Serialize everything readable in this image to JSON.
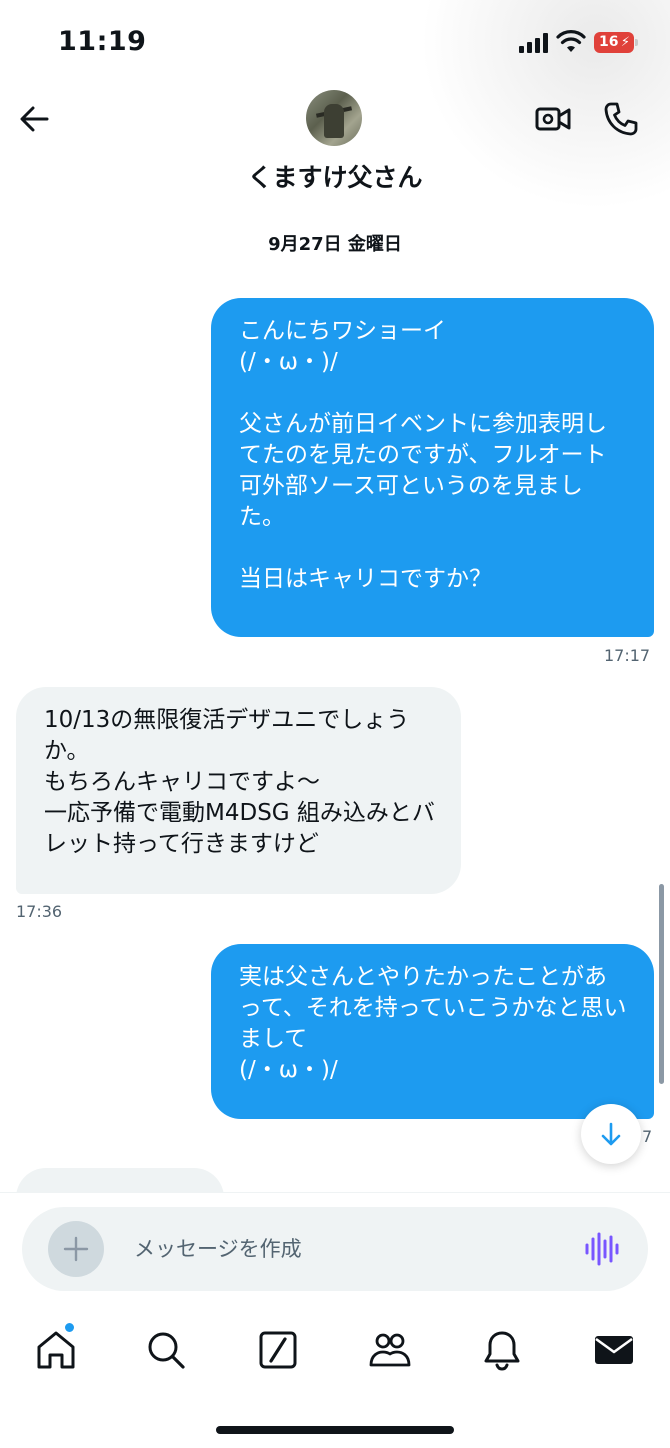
{
  "status_bar": {
    "time": "11:19",
    "battery": "16"
  },
  "header": {
    "contact_name": "くますけ父さん"
  },
  "conversation": {
    "date_separator": "9月27日 金曜日",
    "messages": [
      {
        "direction": "sent",
        "text": "こんにちワショーイ\n(/・ω・)/\n\n父さんが前日イベントに参加表明してたのを見たのですが、フルオート可外部ソース可というのを見ました。\n\n当日はキャリコですか？",
        "time": "17:17"
      },
      {
        "direction": "received",
        "text": "10/13の無限復活デザユニでしょうか。\nもちろんキャリコですよ～\n一応予備で電動M4DSG 組み込みとバレット持って行きますけど",
        "time": "17:36"
      },
      {
        "direction": "sent",
        "text": "実は父さんとやりたかったことがあって、それを持っていこうかなと思いまして\n(/・ω・)/",
        "time": "7"
      }
    ]
  },
  "composer": {
    "placeholder": "メッセージを作成"
  },
  "colors": {
    "accent": "#1d9bf0",
    "received_bubble": "#eff3f4",
    "battery_low": "#e0413a",
    "voice_icon": "#7856ff"
  },
  "icons": [
    "back-arrow-icon",
    "video-call-icon",
    "phone-icon",
    "plus-icon",
    "voice-waveform-icon",
    "arrow-down-icon",
    "home-icon",
    "search-icon",
    "grok-icon",
    "communities-icon",
    "bell-icon",
    "mail-icon"
  ]
}
